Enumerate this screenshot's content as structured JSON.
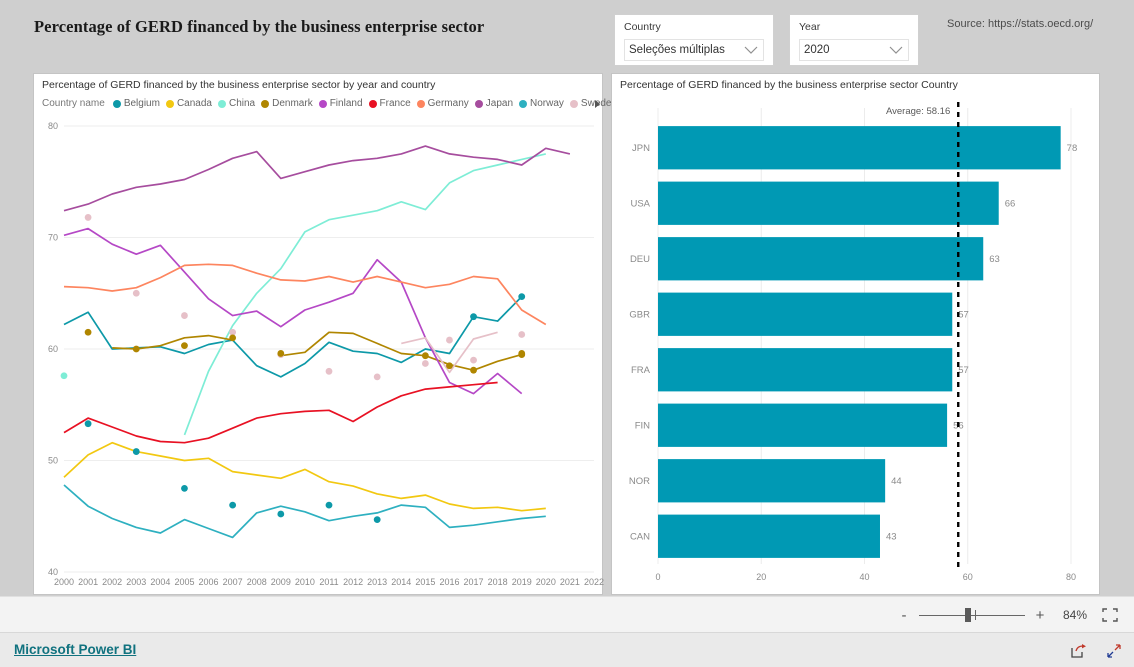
{
  "report": {
    "title": "Percentage of GERD financed by the business enterprise sector",
    "source": "Source: https://stats.oecd.org/"
  },
  "slicers": {
    "country": {
      "label": "Country",
      "value": "Seleções múltiplas"
    },
    "year": {
      "label": "Year",
      "value": "2020"
    }
  },
  "statusbar": {
    "zoom_out": "-",
    "zoom_in": "+",
    "zoom_level": "84%"
  },
  "footer": {
    "brand": "Microsoft Power BI"
  },
  "line_visual": {
    "title": "Percentage of GERD financed by the business enterprise sector by year and country",
    "legend_title": "Country name"
  },
  "bar_visual": {
    "title": "Percentage of GERD financed by the business enterprise sector Country",
    "average_label": "Average: 58.16"
  },
  "chart_data": [
    {
      "type": "line",
      "title": "Percentage of GERD financed by the business enterprise sector by year and country",
      "xlabel": "",
      "ylabel": "",
      "ylim": [
        40,
        80
      ],
      "yticks": [
        40,
        50,
        60,
        70,
        80
      ],
      "grid": true,
      "legend_position": "top",
      "legend_title": "Country name",
      "x": [
        2000,
        2001,
        2002,
        2003,
        2004,
        2005,
        2006,
        2007,
        2008,
        2009,
        2010,
        2011,
        2012,
        2013,
        2014,
        2015,
        2016,
        2017,
        2018,
        2019,
        2020,
        2021,
        2022
      ],
      "series": [
        {
          "name": "Belgium",
          "color": "#0D99A8",
          "values": [
            62.2,
            63.3,
            60.0,
            60.1,
            60.2,
            59.6,
            60.4,
            60.8,
            58.5,
            57.5,
            58.7,
            60.6,
            59.8,
            59.6,
            58.8,
            60.0,
            59.6,
            62.9,
            62.5,
            64.7,
            null,
            null,
            null
          ]
        },
        {
          "name": "Canada",
          "color": "#F2C811",
          "values": [
            48.5,
            50.5,
            51.6,
            50.8,
            50.4,
            50.0,
            50.2,
            49.0,
            48.7,
            48.4,
            49.2,
            48.1,
            47.7,
            47.0,
            46.6,
            46.9,
            46.1,
            45.7,
            45.8,
            45.5,
            45.7,
            null,
            null
          ]
        },
        {
          "name": "China",
          "color": "#7EEDD6",
          "values": [
            57.6,
            null,
            null,
            null,
            null,
            52.3,
            58.0,
            62.1,
            65.0,
            67.2,
            70.5,
            71.6,
            72.0,
            72.4,
            73.2,
            72.5,
            74.9,
            76.0,
            76.5,
            77.0,
            77.5,
            null,
            null
          ]
        },
        {
          "name": "Denmark",
          "color": "#B08600",
          "values": [
            null,
            null,
            60.1,
            60.0,
            60.3,
            61.0,
            61.2,
            60.8,
            null,
            59.4,
            59.7,
            61.5,
            61.4,
            60.5,
            59.6,
            59.4,
            58.6,
            58.1,
            58.9,
            59.5,
            null,
            null,
            null
          ]
        },
        {
          "name": "Finland",
          "color": "#B548C6",
          "values": [
            70.2,
            70.8,
            69.4,
            68.5,
            69.3,
            66.9,
            64.5,
            63.0,
            63.4,
            62.0,
            63.5,
            64.2,
            65.0,
            68.0,
            66.0,
            61.0,
            57.0,
            56.0,
            57.8,
            56.0,
            null,
            null,
            null
          ]
        },
        {
          "name": "France",
          "color": "#E81123",
          "values": [
            52.5,
            53.8,
            53.0,
            52.2,
            51.7,
            51.6,
            52.0,
            52.9,
            53.8,
            54.2,
            54.4,
            54.5,
            53.5,
            54.8,
            55.8,
            56.4,
            56.6,
            56.8,
            57.0,
            null,
            null,
            null,
            null
          ]
        },
        {
          "name": "Germany",
          "color": "#FD855F",
          "values": [
            65.6,
            65.5,
            65.2,
            65.5,
            66.4,
            67.5,
            67.6,
            67.5,
            66.8,
            66.2,
            66.1,
            66.5,
            66.0,
            66.5,
            66.0,
            65.5,
            65.8,
            66.5,
            66.3,
            63.5,
            62.2,
            null,
            null
          ]
        },
        {
          "name": "Japan",
          "color": "#A64D9E",
          "values": [
            72.4,
            73.0,
            73.9,
            74.5,
            74.8,
            75.2,
            76.1,
            77.1,
            77.7,
            75.3,
            75.9,
            76.5,
            76.9,
            77.1,
            77.5,
            78.2,
            77.5,
            77.2,
            77.0,
            76.5,
            78.0,
            77.5,
            null
          ]
        },
        {
          "name": "Norway",
          "color": "#2EB0C0",
          "values": [
            47.8,
            45.9,
            44.8,
            44.0,
            43.5,
            44.7,
            43.9,
            43.1,
            45.3,
            45.9,
            45.4,
            44.6,
            45.0,
            45.3,
            46.0,
            45.8,
            44.0,
            44.2,
            44.5,
            44.8,
            45.0,
            null,
            null
          ]
        },
        {
          "name": "Sweden",
          "color": "#E6C0C8",
          "values": [
            71.8,
            null,
            65.0,
            null,
            64.2,
            null,
            63.1,
            null,
            58.9,
            null,
            58.8,
            null,
            57.9,
            null,
            60.5,
            61.0,
            57.9,
            60.9,
            61.5,
            null,
            null,
            null,
            null
          ]
        }
      ],
      "markers": [
        {
          "series": "Sweden",
          "x": 2001,
          "y": 71.8
        },
        {
          "series": "Sweden",
          "x": 2003,
          "y": 65.0
        },
        {
          "series": "Sweden",
          "x": 2005,
          "y": 63.0
        },
        {
          "series": "Sweden",
          "x": 2007,
          "y": 61.5
        },
        {
          "series": "Sweden",
          "x": 2009,
          "y": 59.5
        },
        {
          "series": "Sweden",
          "x": 2011,
          "y": 58.0
        },
        {
          "series": "Sweden",
          "x": 2013,
          "y": 57.5
        },
        {
          "series": "Sweden",
          "x": 2015,
          "y": 58.7
        },
        {
          "series": "Sweden",
          "x": 2016,
          "y": 60.8
        },
        {
          "series": "Sweden",
          "x": 2017,
          "y": 59.0
        },
        {
          "series": "Sweden",
          "x": 2019,
          "y": 61.3
        },
        {
          "series": "China",
          "x": 2000,
          "y": 57.6
        },
        {
          "series": "Denmark",
          "x": 2001,
          "y": 61.5
        },
        {
          "series": "Denmark",
          "x": 2003,
          "y": 60.0
        },
        {
          "series": "Denmark",
          "x": 2005,
          "y": 60.3
        },
        {
          "series": "Denmark",
          "x": 2007,
          "y": 61.0
        },
        {
          "series": "Denmark",
          "x": 2009,
          "y": 59.6
        },
        {
          "series": "Denmark",
          "x": 2015,
          "y": 59.4
        },
        {
          "series": "Denmark",
          "x": 2017,
          "y": 58.1
        },
        {
          "series": "Denmark",
          "x": 2019,
          "y": 59.5
        },
        {
          "series": "Belgium",
          "x": 2001,
          "y": 53.3
        },
        {
          "series": "Belgium",
          "x": 2003,
          "y": 50.8
        },
        {
          "series": "Belgium",
          "x": 2005,
          "y": 47.5
        },
        {
          "series": "Belgium",
          "x": 2007,
          "y": 46.0
        },
        {
          "series": "Belgium",
          "x": 2009,
          "y": 45.2
        },
        {
          "series": "Belgium",
          "x": 2011,
          "y": 46.0
        },
        {
          "series": "Belgium",
          "x": 2013,
          "y": 44.7
        },
        {
          "series": "Belgium",
          "x": 2017,
          "y": 62.9
        },
        {
          "series": "Belgium",
          "x": 2019,
          "y": 64.7
        },
        {
          "series": "Denmark",
          "x": 2016,
          "y": 58.5
        },
        {
          "series": "Denmark",
          "x": 2019,
          "y": 59.6
        }
      ]
    },
    {
      "type": "bar",
      "orientation": "horizontal",
      "title": "Percentage of GERD financed by the business enterprise sector Country",
      "categories": [
        "JPN",
        "USA",
        "DEU",
        "GBR",
        "FRA",
        "FIN",
        "NOR",
        "CAN"
      ],
      "values": [
        78,
        66,
        63,
        57,
        57,
        56,
        44,
        43
      ],
      "labels": [
        "78",
        "66",
        "63",
        "57",
        "57",
        "56",
        "44",
        "43"
      ],
      "bar_color": "#0099B4",
      "xlim": [
        0,
        80
      ],
      "xticks": [
        0,
        20,
        40,
        60,
        80
      ],
      "xtick_labels": [
        "0",
        "20",
        "40",
        "60",
        "80"
      ],
      "average": 58.16,
      "average_label": "Average: 58.16",
      "average_color": "#000000",
      "grid": true
    }
  ]
}
